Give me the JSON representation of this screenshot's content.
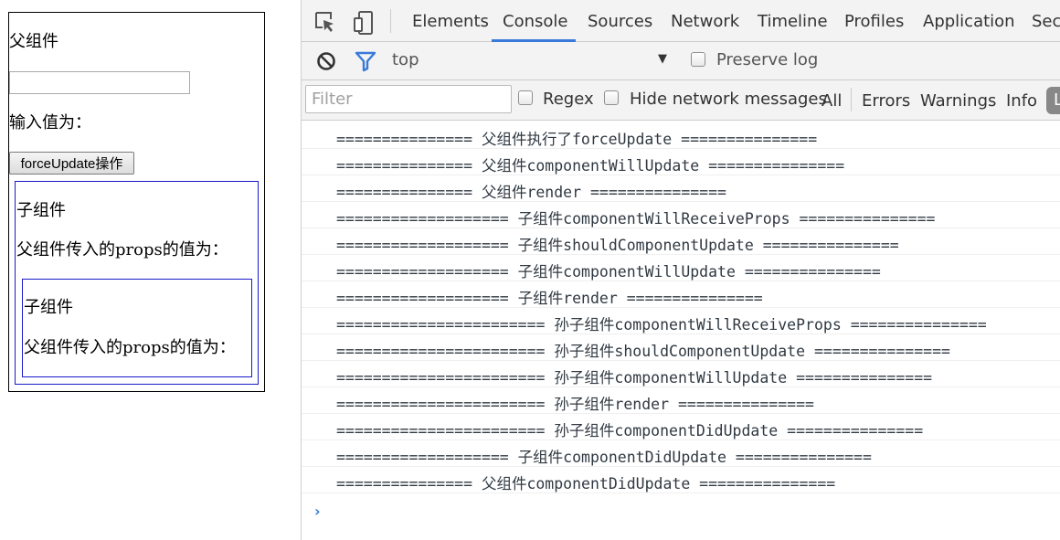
{
  "page": {
    "parent_title": "父组件",
    "parent_input_value": "",
    "parent_input_label": "输入值为：",
    "force_update_button": "forceUpdate操作",
    "child_title": "子组件",
    "child_props_label": "父组件传入的props的值为：",
    "grandchild_title": "子组件",
    "grandchild_props_label": "父组件传入的props的值为："
  },
  "devtools": {
    "tabs": [
      "Elements",
      "Console",
      "Sources",
      "Network",
      "Timeline",
      "Profiles",
      "Application",
      "Secu"
    ],
    "active_tab": "Console",
    "toolbar": {
      "context": "top",
      "preserve_log_label": "Preserve log"
    },
    "filterbar": {
      "filter_placeholder": "Filter",
      "regex_label": "Regex",
      "hide_network_label": "Hide network messages",
      "levels": [
        "All",
        "Errors",
        "Warnings",
        "Info",
        "Lo"
      ]
    },
    "accent_color": "#3879d9",
    "console_lines": [
      "=============== 父组件执行了forceUpdate ===============",
      "=============== 父组件componentWillUpdate ===============",
      "=============== 父组件render ===============",
      "=================== 子组件componentWillReceiveProps ===============",
      "=================== 子组件shouldComponentUpdate ===============",
      "=================== 子组件componentWillUpdate ===============",
      "=================== 子组件render ===============",
      "======================= 孙子组件componentWillReceiveProps ===============",
      "======================= 孙子组件shouldComponentUpdate ===============",
      "======================= 孙子组件componentWillUpdate ===============",
      "======================= 孙子组件render ===============",
      "======================= 孙子组件componentDidUpdate ===============",
      "=================== 子组件componentDidUpdate ===============",
      "=============== 父组件componentDidUpdate ==============="
    ],
    "prompt_symbol": "›"
  }
}
